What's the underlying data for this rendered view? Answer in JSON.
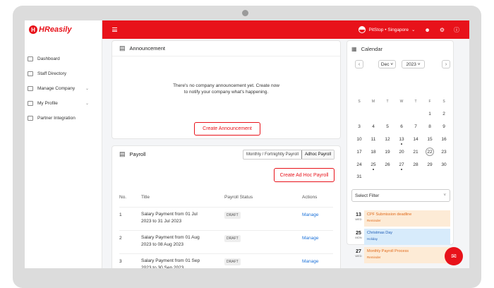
{
  "brand": {
    "logo_mark": "H",
    "name": "HReasily",
    "color": "#e8121a"
  },
  "sidebar": {
    "items": [
      {
        "label": "Dashboard",
        "icon": "dashboard-icon",
        "chevron": ""
      },
      {
        "label": "Staff Directory",
        "icon": "staff-icon",
        "chevron": ""
      },
      {
        "label": "Manage Company",
        "icon": "company-icon",
        "chevron": "⌄"
      },
      {
        "label": "My Profile",
        "icon": "profile-icon",
        "chevron": "⌄"
      },
      {
        "label": "Partner Integration",
        "icon": "integration-icon",
        "chevron": ""
      }
    ]
  },
  "topbar": {
    "company": "PitStop • Singapore",
    "chevron": "⌄"
  },
  "announcement": {
    "title": "Announcement",
    "empty_line1": "There's no company announcement yet. Create now",
    "empty_line2": "to notify your company what's happening.",
    "create_button": "Create Announcement"
  },
  "payroll": {
    "title": "Payroll",
    "tabs": [
      "Monthly / Fortnightly Payroll",
      "Adhoc Payroll"
    ],
    "active_tab": "Adhoc Payroll",
    "create_button": "Create Ad Hoc Payroll",
    "columns": {
      "no": "No.",
      "title": "Title",
      "status": "Payroll Status",
      "actions": "Actions"
    },
    "rows": [
      {
        "no": "1",
        "title_line1": "Salary Payment from 01 Jul",
        "title_line2": "2023 to 31 Jul 2023",
        "status": "DRAFT",
        "action": "Manage"
      },
      {
        "no": "2",
        "title_line1": "Salary Payment from 01 Aug",
        "title_line2": "2023 to 08 Aug 2023",
        "status": "DRAFT",
        "action": "Manage"
      },
      {
        "no": "3",
        "title_line1": "Salary Payment from 01 Sep",
        "title_line2": "2023 to 30 Sep 2023",
        "status": "DRAFT",
        "action": "Manage"
      }
    ]
  },
  "calendar": {
    "title": "Calendar",
    "month": "Dec",
    "year": "2023",
    "weekdays": [
      "S",
      "M",
      "T",
      "W",
      "T",
      "F",
      "S"
    ],
    "days": [
      "",
      "",
      "",
      "",
      "",
      "1",
      "2",
      "3",
      "4",
      "5",
      "6",
      "7",
      "8",
      "9",
      "10",
      "11",
      "12",
      "13",
      "14",
      "15",
      "16",
      "17",
      "18",
      "19",
      "20",
      "21",
      "22",
      "23",
      "24",
      "25",
      "26",
      "27",
      "28",
      "29",
      "30",
      "31"
    ],
    "today": "22",
    "event_days": [
      "13",
      "25",
      "27"
    ],
    "filter_placeholder": "Select Filter",
    "events": [
      {
        "day": "13",
        "weekday": "WED",
        "title": "CPF Submission deadline",
        "type": "Reminder",
        "style": "orange"
      },
      {
        "day": "25",
        "weekday": "MON",
        "title": "Christmas Day",
        "type": "Holiday",
        "style": "blue"
      },
      {
        "day": "27",
        "weekday": "WED",
        "title": "Monthly Payroll Process",
        "type": "Reminder",
        "style": "orange"
      }
    ],
    "event_colors": {
      "orange_bg": "#fdebd6",
      "blue_bg": "#d7ebfb"
    }
  },
  "chat": {
    "icon": "chat-icon"
  }
}
